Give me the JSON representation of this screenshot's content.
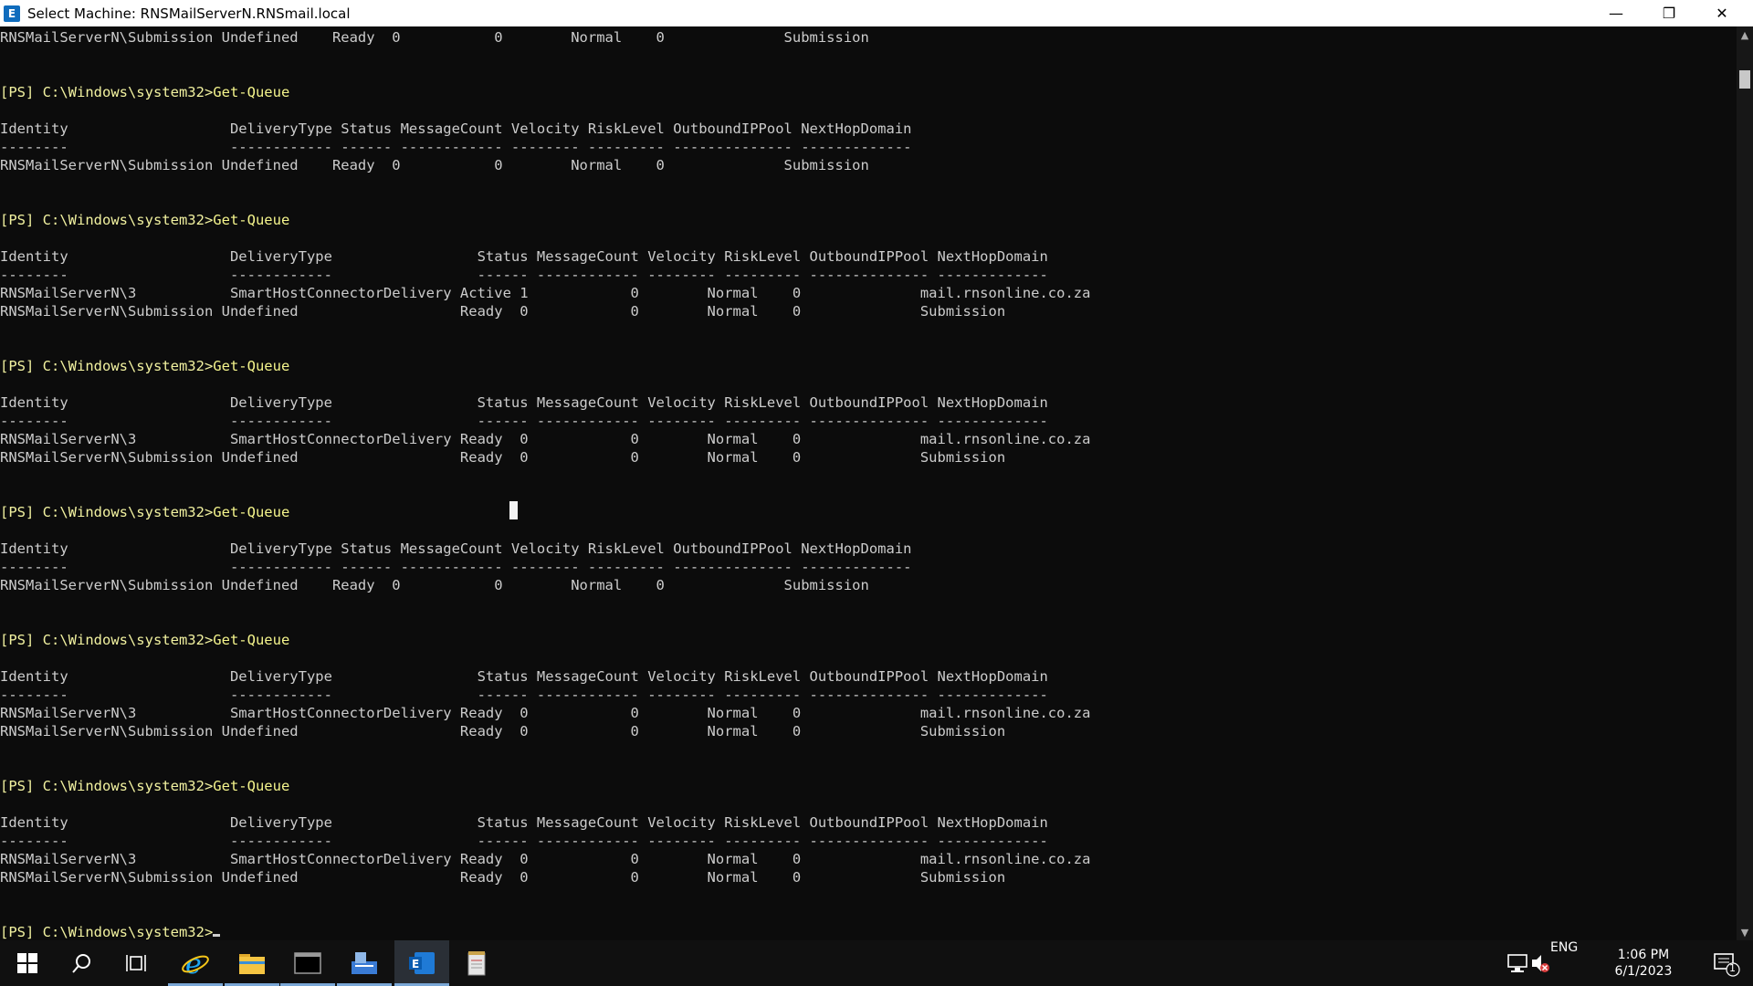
{
  "window": {
    "title": "Select Machine: RNSMailServerN.RNSmail.local",
    "icon_letter": "E",
    "minimize_glyph": "—",
    "maximize_glyph": "❐",
    "close_glyph": "✕"
  },
  "console": {
    "lines": [
      {
        "type": "text",
        "text": "RNSMailServerN\\Submission Undefined    Ready  0           0        Normal    0              Submission"
      },
      {
        "type": "blank",
        "text": ""
      },
      {
        "type": "blank",
        "text": ""
      },
      {
        "type": "cmd",
        "prompt": "[PS] C:\\Windows\\system32>",
        "cmd": "Get-Queue"
      },
      {
        "type": "blank",
        "text": ""
      },
      {
        "type": "text",
        "text": "Identity                   DeliveryType Status MessageCount Velocity RiskLevel OutboundIPPool NextHopDomain"
      },
      {
        "type": "text",
        "text": "--------                   ------------ ------ ------------ -------- --------- -------------- -------------"
      },
      {
        "type": "text",
        "text": "RNSMailServerN\\Submission Undefined    Ready  0           0        Normal    0              Submission"
      },
      {
        "type": "blank",
        "text": ""
      },
      {
        "type": "blank",
        "text": ""
      },
      {
        "type": "cmd",
        "prompt": "[PS] C:\\Windows\\system32>",
        "cmd": "Get-Queue"
      },
      {
        "type": "blank",
        "text": ""
      },
      {
        "type": "text",
        "text": "Identity                   DeliveryType                 Status MessageCount Velocity RiskLevel OutboundIPPool NextHopDomain"
      },
      {
        "type": "text",
        "text": "--------                   ------------                 ------ ------------ -------- --------- -------------- -------------"
      },
      {
        "type": "text",
        "text": "RNSMailServerN\\3           SmartHostConnectorDelivery Active 1            0        Normal    0              mail.rnsonline.co.za"
      },
      {
        "type": "text",
        "text": "RNSMailServerN\\Submission Undefined                   Ready  0            0        Normal    0              Submission"
      },
      {
        "type": "blank",
        "text": ""
      },
      {
        "type": "blank",
        "text": ""
      },
      {
        "type": "cmd",
        "prompt": "[PS] C:\\Windows\\system32>",
        "cmd": "Get-Queue"
      },
      {
        "type": "blank",
        "text": ""
      },
      {
        "type": "text",
        "text": "Identity                   DeliveryType                 Status MessageCount Velocity RiskLevel OutboundIPPool NextHopDomain"
      },
      {
        "type": "text",
        "text": "--------                   ------------                 ------ ------------ -------- --------- -------------- -------------"
      },
      {
        "type": "text",
        "text": "RNSMailServerN\\3           SmartHostConnectorDelivery Ready  0            0        Normal    0              mail.rnsonline.co.za"
      },
      {
        "type": "text",
        "text": "RNSMailServerN\\Submission Undefined                   Ready  0            0        Normal    0              Submission"
      },
      {
        "type": "blank",
        "text": ""
      },
      {
        "type": "blank",
        "text": ""
      },
      {
        "type": "cmd",
        "prompt": "[PS] C:\\Windows\\system32>",
        "cmd": "Get-Queue"
      },
      {
        "type": "blank",
        "text": ""
      },
      {
        "type": "text",
        "text": "Identity                   DeliveryType Status MessageCount Velocity RiskLevel OutboundIPPool NextHopDomain"
      },
      {
        "type": "text",
        "text": "--------                   ------------ ------ ------------ -------- --------- -------------- -------------"
      },
      {
        "type": "text",
        "text": "RNSMailServerN\\Submission Undefined    Ready  0           0        Normal    0              Submission"
      },
      {
        "type": "blank",
        "text": ""
      },
      {
        "type": "blank",
        "text": ""
      },
      {
        "type": "cmd",
        "prompt": "[PS] C:\\Windows\\system32>",
        "cmd": "Get-Queue"
      },
      {
        "type": "blank",
        "text": ""
      },
      {
        "type": "text",
        "text": "Identity                   DeliveryType                 Status MessageCount Velocity RiskLevel OutboundIPPool NextHopDomain"
      },
      {
        "type": "text",
        "text": "--------                   ------------                 ------ ------------ -------- --------- -------------- -------------"
      },
      {
        "type": "text",
        "text": "RNSMailServerN\\3           SmartHostConnectorDelivery Ready  0            0        Normal    0              mail.rnsonline.co.za"
      },
      {
        "type": "text",
        "text": "RNSMailServerN\\Submission Undefined                   Ready  0            0        Normal    0              Submission"
      },
      {
        "type": "blank",
        "text": ""
      },
      {
        "type": "blank",
        "text": ""
      },
      {
        "type": "cmd",
        "prompt": "[PS] C:\\Windows\\system32>",
        "cmd": "Get-Queue"
      },
      {
        "type": "blank",
        "text": ""
      },
      {
        "type": "text",
        "text": "Identity                   DeliveryType                 Status MessageCount Velocity RiskLevel OutboundIPPool NextHopDomain"
      },
      {
        "type": "text",
        "text": "--------                   ------------                 ------ ------------ -------- --------- -------------- -------------"
      },
      {
        "type": "text",
        "text": "RNSMailServerN\\3           SmartHostConnectorDelivery Ready  0            0        Normal    0              mail.rnsonline.co.za"
      },
      {
        "type": "text",
        "text": "RNSMailServerN\\Submission Undefined                   Ready  0            0        Normal    0              Submission"
      },
      {
        "type": "blank",
        "text": ""
      },
      {
        "type": "blank",
        "text": ""
      },
      {
        "type": "cmd",
        "prompt": "[PS] C:\\Windows\\system32>",
        "cmd": ""
      }
    ]
  },
  "scrollbar": {
    "up_glyph": "▲",
    "down_glyph": "▼"
  },
  "taskbar": {
    "items": [
      {
        "name": "start-icon",
        "glyph": "⊞"
      },
      {
        "name": "search-icon",
        "glyph": "⌕"
      },
      {
        "name": "task-view-icon",
        "glyph": "❐"
      },
      {
        "name": "internet-explorer-icon",
        "glyph": "e"
      },
      {
        "name": "file-explorer-icon",
        "glyph": "▭"
      },
      {
        "name": "command-prompt-icon",
        "glyph": "▬"
      },
      {
        "name": "server-manager-icon",
        "glyph": "▤"
      },
      {
        "name": "exchange-shell-icon",
        "glyph": "E"
      },
      {
        "name": "notepad-icon",
        "glyph": "▯"
      }
    ],
    "tray": {
      "network_glyph": "🖧",
      "volume_glyph": "🔇",
      "language": "ENG",
      "time": "1:06 PM",
      "date": "6/1/2023",
      "notification_glyph": "🗨",
      "notification_count": "1"
    }
  },
  "colors": {
    "console_bg": "#0c0c0c",
    "prompt": "#f2f2a0",
    "text": "#cccccc",
    "taskbar": "#101010"
  }
}
